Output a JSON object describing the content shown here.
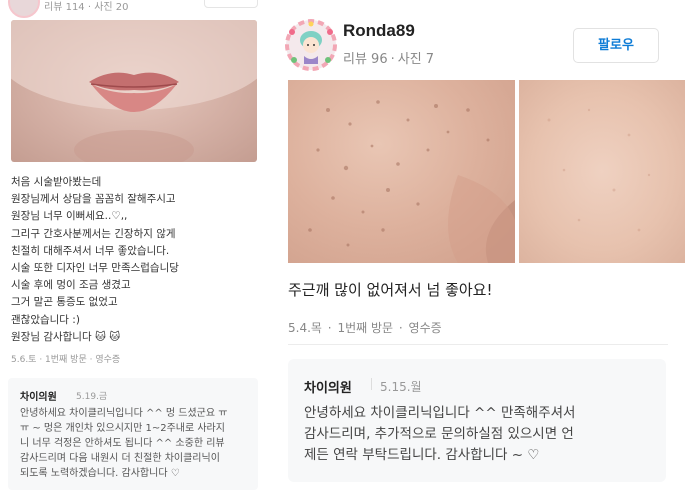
{
  "left_review": {
    "stats": "리뷰 114 · 사진 20",
    "text_lines": [
      "처음 시술받아봤는데",
      "원장님께서 상담을 꼼꼼히 잘해주시고",
      "원장님 너무 이뻐세요..♡,,",
      "그리구 간호사분께서는 긴장하지 않게",
      "친절히 대해주셔서 너무 좋았습니다.",
      "시술 또한 디자인 너무 만족스럽습니당",
      "시술 후에 멍이 조금 생겼고",
      "그거 말곤 통증도 없었고",
      "괜찮았습니다 :)",
      "원장님 감사합니다 🐱 🐱"
    ],
    "meta": "5.6.토 · 1번째 방문 · 영수증",
    "reply": {
      "name": "차이의원",
      "date": "5.19.금",
      "text_lines": [
        "안녕하세요 차이클리닉입니다 ^^ 멍 드셨군요 ㅠ",
        "ㅠ ~ 멍은 개인차 있으시지만 1~2주내로 사라지",
        "니 너무 걱정은 안하셔도 됩니다 ^^ 소중한 리뷰",
        "감사드리며 다음 내원시 더 친절한 차이클리닉이",
        "되도록 노력하겠습니다. 감사합니다 ♡"
      ]
    }
  },
  "main_review": {
    "username": "Ronda89",
    "stats": {
      "reviews": "리뷰 96",
      "dot": "·",
      "photos": "사진 7"
    },
    "follow_label": "팔로우",
    "review_text": "주근깨 많이 없어져서 넘 좋아요!",
    "visit_meta": {
      "date": "5.4.목",
      "visit": "1번째 방문",
      "receipt": "영수증",
      "sep": "·"
    },
    "reply": {
      "name": "차이의원",
      "date": "5.15.월",
      "text_lines": [
        "안녕하세요 차이클리닉입니다 ^^ 만족해주셔서",
        "감사드리며, 추가적으로 문의하실점 있으시면 언",
        "제든 연락 부탁드립니다. 감사합니다 ~ ♡"
      ]
    }
  },
  "colors": {
    "follow_text": "#0e7cd6",
    "reply_bg": "#f7f8f9",
    "meta_gray": "#888888"
  }
}
